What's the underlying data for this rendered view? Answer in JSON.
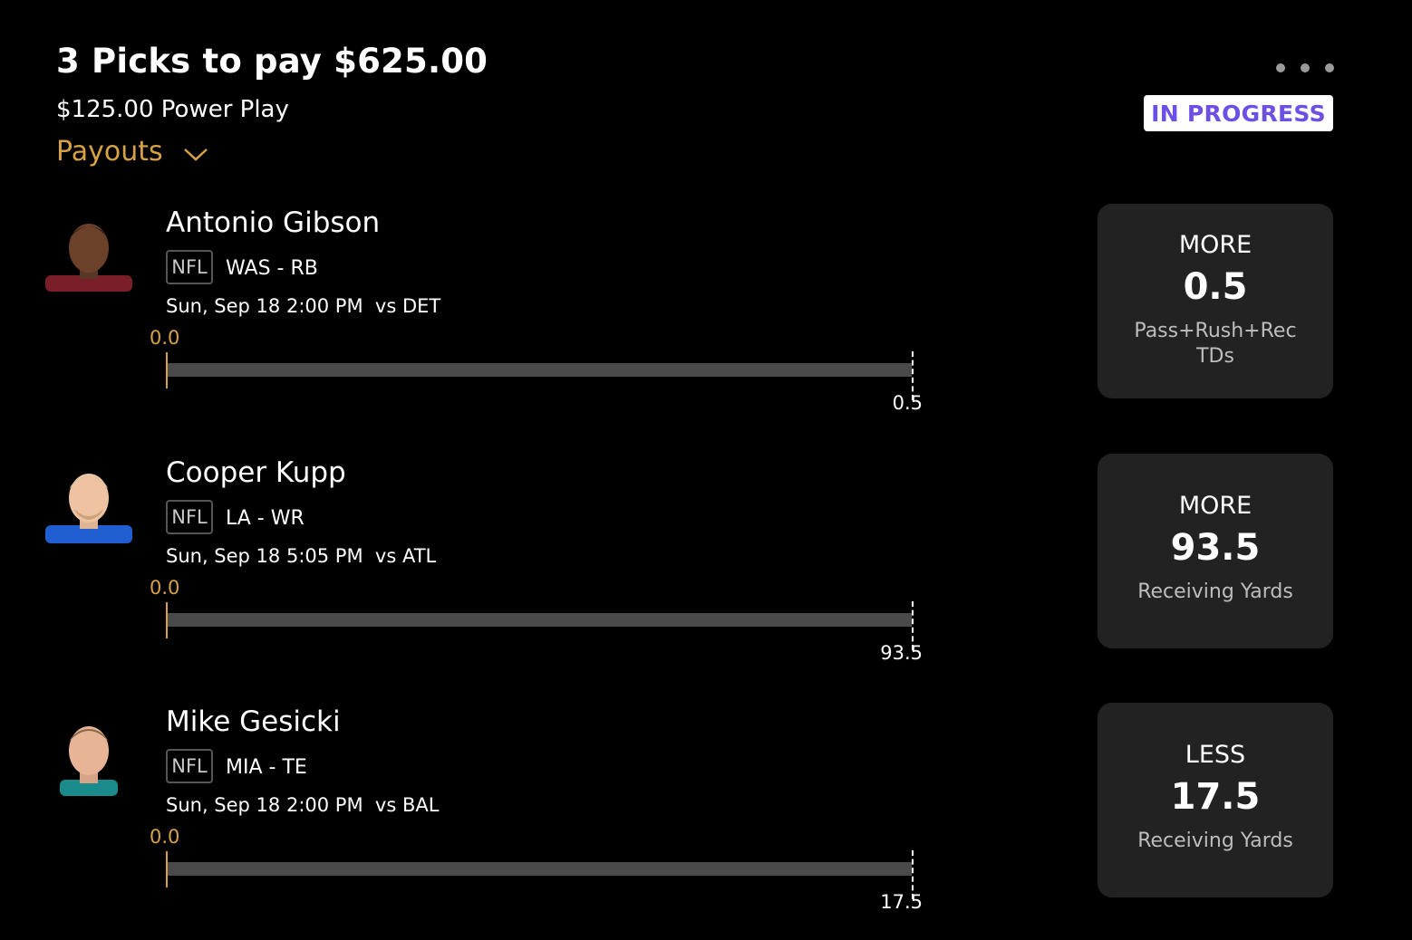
{
  "header": {
    "title": "3 Picks to pay $625.00",
    "subtitle": "$125.00 Power Play",
    "payouts_label": "Payouts",
    "status": "IN PROGRESS"
  },
  "picks": [
    {
      "name": "Antonio Gibson",
      "league": "NFL",
      "team_position": "WAS - RB",
      "game": "Sun, Sep 18 2:00 PM  vs DET",
      "start_value": "0.0",
      "line_value": "0.5",
      "progress": 0,
      "direction": "MORE",
      "line": "0.5",
      "stat": "Pass+Rush+Rec TDs",
      "jersey_color": "#7a1e2a"
    },
    {
      "name": "Cooper Kupp",
      "league": "NFL",
      "team_position": "LA - WR",
      "game": "Sun, Sep 18 5:05 PM  vs ATL",
      "start_value": "0.0",
      "line_value": "93.5",
      "progress": 0,
      "direction": "MORE",
      "line": "93.5",
      "stat": "Receiving Yards",
      "jersey_color": "#1f5fd1"
    },
    {
      "name": "Mike Gesicki",
      "league": "NFL",
      "team_position": "MIA - TE",
      "game": "Sun, Sep 18 2:00 PM  vs BAL",
      "start_value": "0.0",
      "line_value": "17.5",
      "progress": 0,
      "direction": "LESS",
      "line": "17.5",
      "stat": "Receiving Yards",
      "jersey_color": "#1b8a8a"
    }
  ]
}
